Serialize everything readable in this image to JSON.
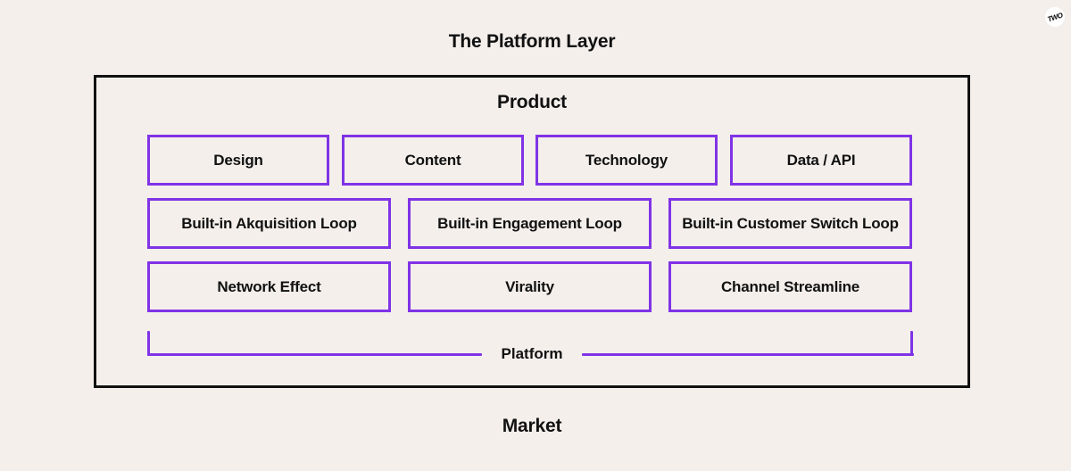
{
  "title": "The Platform Layer",
  "logo": {
    "text": "TWO",
    "icon": "brand-logo-icon"
  },
  "product_label": "Product",
  "market_label": "Market",
  "platform_label": "Platform",
  "colors": {
    "background": "#f4efeb",
    "accent": "#8033e6",
    "frame": "#111111",
    "text": "#111111"
  },
  "rows": [
    {
      "items": [
        "Design",
        "Content",
        "Technology",
        "Data / API"
      ]
    },
    {
      "items": [
        "Built-in Akquisition Loop",
        "Built-in Engagement Loop",
        "Built-in Customer Switch Loop"
      ]
    },
    {
      "items": [
        "Network Effect",
        "Virality",
        "Channel Streamline"
      ]
    }
  ]
}
